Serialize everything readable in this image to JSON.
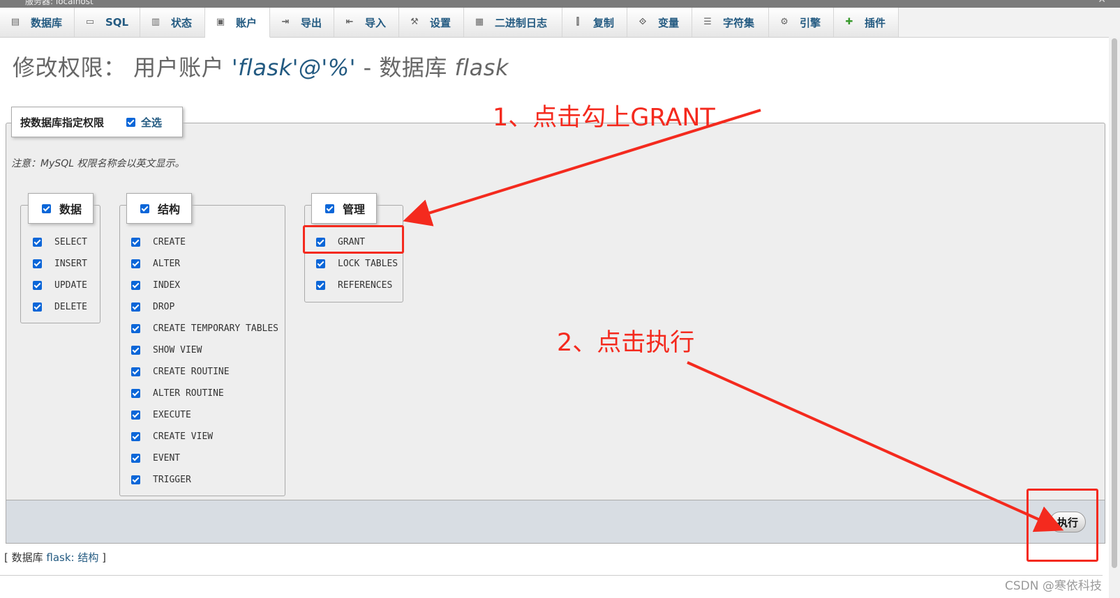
{
  "window": {
    "server_label": "服务器: localhost"
  },
  "tabs": [
    {
      "label": "数据库",
      "icon": "database-icon"
    },
    {
      "label": "SQL",
      "icon": "sql-icon"
    },
    {
      "label": "状态",
      "icon": "status-icon"
    },
    {
      "label": "账户",
      "icon": "accounts-icon"
    },
    {
      "label": "导出",
      "icon": "export-icon"
    },
    {
      "label": "导入",
      "icon": "import-icon"
    },
    {
      "label": "设置",
      "icon": "wrench-icon"
    },
    {
      "label": "二进制日志",
      "icon": "binlog-icon"
    },
    {
      "label": "复制",
      "icon": "replication-icon"
    },
    {
      "label": "变量",
      "icon": "variables-icon"
    },
    {
      "label": "字符集",
      "icon": "charset-icon"
    },
    {
      "label": "引擎",
      "icon": "engine-icon"
    },
    {
      "label": "插件",
      "icon": "plugin-icon"
    }
  ],
  "active_tab": "账户",
  "title": {
    "prefix": "修改权限：  用户账户",
    "user": "'flask'@'%'",
    "sep": " - 数据库 ",
    "db": "flask"
  },
  "fieldset": {
    "legend": "按数据库指定权限",
    "select_all": "全选"
  },
  "note": "注意：MySQL 权限名称会以英文显示。",
  "groups": {
    "data": {
      "label": "数据",
      "items": [
        "SELECT",
        "INSERT",
        "UPDATE",
        "DELETE"
      ]
    },
    "structure": {
      "label": "结构",
      "items": [
        "CREATE",
        "ALTER",
        "INDEX",
        "DROP",
        "CREATE TEMPORARY TABLES",
        "SHOW VIEW",
        "CREATE ROUTINE",
        "ALTER ROUTINE",
        "EXECUTE",
        "CREATE VIEW",
        "EVENT",
        "TRIGGER"
      ]
    },
    "admin": {
      "label": "管理",
      "items": [
        "GRANT",
        "LOCK TABLES",
        "REFERENCES"
      ]
    }
  },
  "go_button": "执行",
  "footer_link": {
    "open": "[ 数据库 ",
    "db_link": "flask:",
    "struct_link": "结构",
    "close": " ]"
  },
  "annotations": {
    "step1": "1、点击勾上GRANT",
    "step2": "2、点击执行"
  },
  "watermark": "CSDN @寒依科技",
  "colors": {
    "annotation": "#f42a1e",
    "link": "#235a81",
    "checkbox": "#0b66d8"
  }
}
